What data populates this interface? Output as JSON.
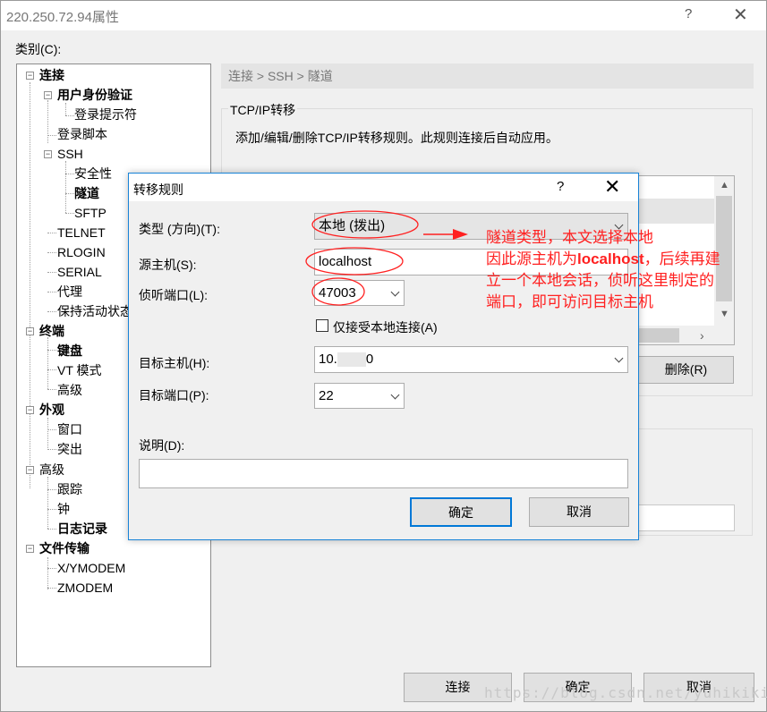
{
  "window": {
    "title": "220.250.72.94属性",
    "help": "?",
    "close": "✕"
  },
  "category": {
    "label": "类别(C):",
    "items": [
      {
        "label": "连接"
      },
      {
        "label": "用户身份验证"
      },
      {
        "label": "登录提示符"
      },
      {
        "label": "登录脚本"
      },
      {
        "label": "SSH"
      },
      {
        "label": "安全性"
      },
      {
        "label": "隧道"
      },
      {
        "label": "SFTP"
      },
      {
        "label": "TELNET"
      },
      {
        "label": "RLOGIN"
      },
      {
        "label": "SERIAL"
      },
      {
        "label": "代理"
      },
      {
        "label": "保持活动状态"
      },
      {
        "label": "终端"
      },
      {
        "label": "键盘"
      },
      {
        "label": "VT 模式"
      },
      {
        "label": "高级"
      },
      {
        "label": "外观"
      },
      {
        "label": "窗口"
      },
      {
        "label": "突出"
      },
      {
        "label": "高级"
      },
      {
        "label": "跟踪"
      },
      {
        "label": "钟"
      },
      {
        "label": "日志记录"
      },
      {
        "label": "文件传输"
      },
      {
        "label": "X/YMODEM"
      },
      {
        "label": "ZMODEM"
      }
    ]
  },
  "breadcrumb": "连接 > SSH > 隧道",
  "tcpip": {
    "group_label": "TCP/IP转移",
    "description": "添加/编辑/删除TCP/IP转移规则。此规则连接后自动应用。",
    "delete_button": "删除(R)"
  },
  "footer": {
    "connect": "连接",
    "ok": "确定",
    "cancel": "取消"
  },
  "watermark": "https://blog.csdn.net/yuhikiki",
  "dialog": {
    "title": "转移规则",
    "help": "?",
    "close": "✕",
    "type_label": "类型 (方向)(T):",
    "type_value": "本地 (拨出)",
    "source_host_label": "源主机(S):",
    "source_host_value": "localhost",
    "listen_port_label": "侦听端口(L):",
    "listen_port_value": "47003",
    "local_only_label": "仅接受本地连接(A)",
    "target_host_label": "目标主机(H):",
    "target_host_prefix": "10.",
    "target_host_suffix": "0",
    "target_port_label": "目标端口(P):",
    "target_port_value": "22",
    "description_label": "说明(D):",
    "description_value": "",
    "ok": "确定",
    "cancel": "取消"
  },
  "annotation": {
    "line1": "隧道类型，本文选择本地",
    "line2_a": "因此源主机为",
    "line2_b": "localhost",
    "line2_c": "，后续再建",
    "line3": "立一个本地会话，侦听这里制定的",
    "line4": "端口，即可访问目标主机",
    "color": "#ff2020"
  }
}
